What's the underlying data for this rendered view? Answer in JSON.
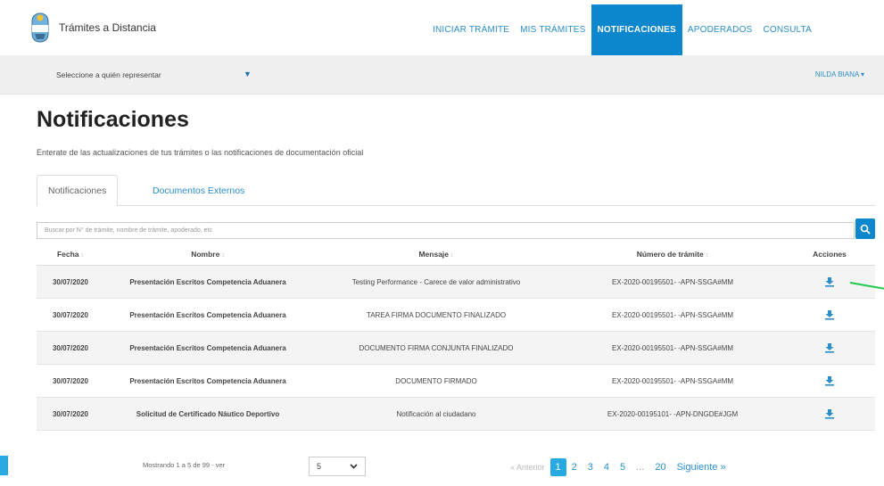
{
  "brand": {
    "name": "Trámites a Distancia"
  },
  "nav": {
    "items": [
      {
        "label": "INICIAR TRÁMITE",
        "active": false
      },
      {
        "label": "MIS TRÁMITES",
        "active": false
      },
      {
        "label": "NOTIFICACIONES",
        "active": true
      },
      {
        "label": "APODERADOS",
        "active": false
      },
      {
        "label": "CONSULTA",
        "active": false
      }
    ]
  },
  "subbar": {
    "represent_label": "Seleccione a quién representar",
    "represent_caret": "▼",
    "user_name": "NILDA BIANA ▾"
  },
  "page": {
    "title": "Notificaciones",
    "description": "Enterate de las actualizaciones de tus trámites o las notificaciones de documentación oficial"
  },
  "tabs": [
    {
      "label": "Notificaciones",
      "active": true
    },
    {
      "label": "Documentos Externos",
      "active": false
    }
  ],
  "search": {
    "placeholder": "Buscar por N° de trámite, nombre de trámite, apoderado, etc"
  },
  "table": {
    "headers": {
      "fecha": "Fecha",
      "nombre": "Nombre",
      "mensaje": "Mensaje",
      "numero": "Número de trámite",
      "acciones": "Acciones"
    },
    "sort_glyph": "↕",
    "rows": [
      {
        "fecha": "30/07/2020",
        "nombre": "Presentación Escritos Competencia Aduanera",
        "mensaje": "Testing Performance - Carece de valor administrativo",
        "numero": "EX-2020-00195501- -APN-SSGA#MM"
      },
      {
        "fecha": "30/07/2020",
        "nombre": "Presentación Escritos Competencia Aduanera",
        "mensaje": "TAREA FIRMA DOCUMENTO FINALIZADO",
        "numero": "EX-2020-00195501- -APN-SSGA#MM"
      },
      {
        "fecha": "30/07/2020",
        "nombre": "Presentación Escritos Competencia Aduanera",
        "mensaje": "DOCUMENTO FIRMA CONJUNTA FINALIZADO",
        "numero": "EX-2020-00195501- -APN-SSGA#MM"
      },
      {
        "fecha": "30/07/2020",
        "nombre": "Presentación Escritos Competencia Aduanera",
        "mensaje": "DOCUMENTO FIRMADO",
        "numero": "EX-2020-00195501- -APN-SSGA#MM"
      },
      {
        "fecha": "30/07/2020",
        "nombre": "Solicitud de Certificado Náutico Deportivo",
        "mensaje": "Notificación al ciudadano",
        "numero": "EX-2020-00195101- -APN-DNGDE#JGM"
      }
    ]
  },
  "footer": {
    "showing_text": "Mostrando 1 a 5 de 99 - ver",
    "page_size": "5",
    "prev_label": "« Anterior",
    "pages": [
      "1",
      "2",
      "3",
      "4",
      "5",
      "...",
      "20"
    ],
    "current_page": "1",
    "next_label": "Siguiente »"
  },
  "colors": {
    "primary": "#0c86cc",
    "link": "#2a8ec9",
    "marker": "#1dc84a"
  }
}
